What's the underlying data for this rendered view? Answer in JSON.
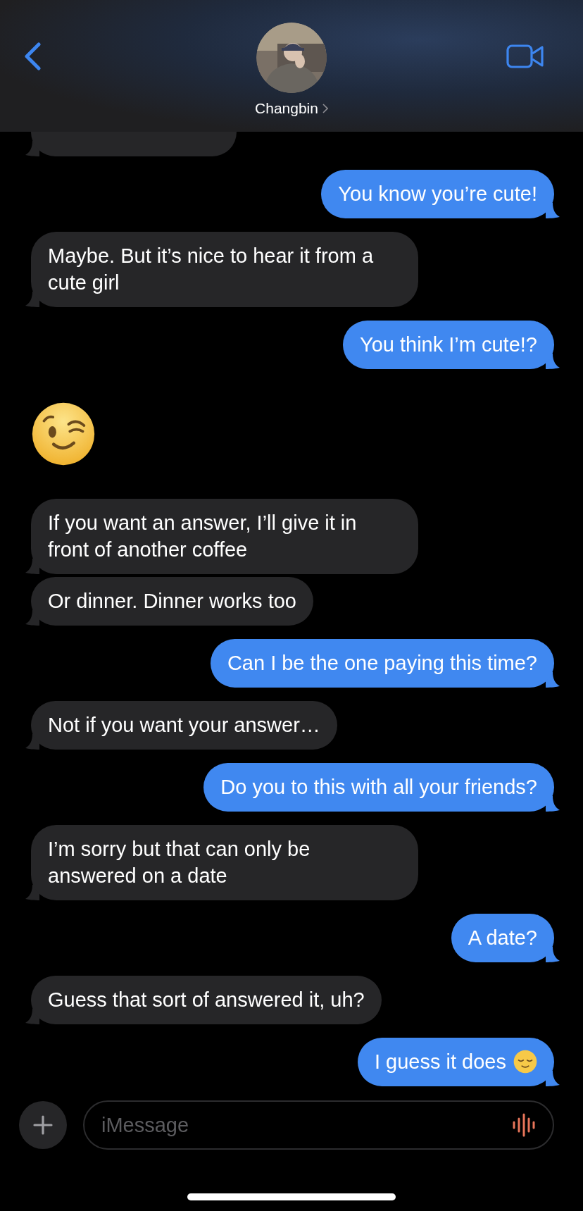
{
  "header": {
    "contact_name": "Changbin"
  },
  "messages": [
    {
      "kind": "text",
      "sent": false
    },
    {
      "kind": "text",
      "sent": true,
      "text": "You know you’re cute!"
    },
    {
      "kind": "text",
      "sent": false,
      "text": "Maybe. But it’s nice to hear it from a cute girl"
    },
    {
      "kind": "text",
      "sent": true,
      "text": "You think I’m cute!?"
    },
    {
      "kind": "emoji",
      "sent": false
    },
    {
      "kind": "text",
      "sent": false,
      "text": "If you want an answer, I’ll give it in front of another coffee"
    },
    {
      "kind": "text",
      "sent": false,
      "text": "Or dinner. Dinner works too"
    },
    {
      "kind": "text",
      "sent": true,
      "text": "Can I be the one paying this time?"
    },
    {
      "kind": "text",
      "sent": false,
      "text": "Not if you want your answer…"
    },
    {
      "kind": "text",
      "sent": true,
      "text": "Do you to this with all your friends?"
    },
    {
      "kind": "text",
      "sent": false,
      "text": "I’m sorry but that can only be answered on a date"
    },
    {
      "kind": "text",
      "sent": true,
      "text": "A date?"
    },
    {
      "kind": "text",
      "sent": false,
      "text": "Guess that sort of answered it, uh?"
    },
    {
      "kind": "text",
      "sent": true,
      "text": "I guess it does",
      "trailing_emoji": true
    }
  ],
  "composer": {
    "placeholder": "iMessage"
  }
}
